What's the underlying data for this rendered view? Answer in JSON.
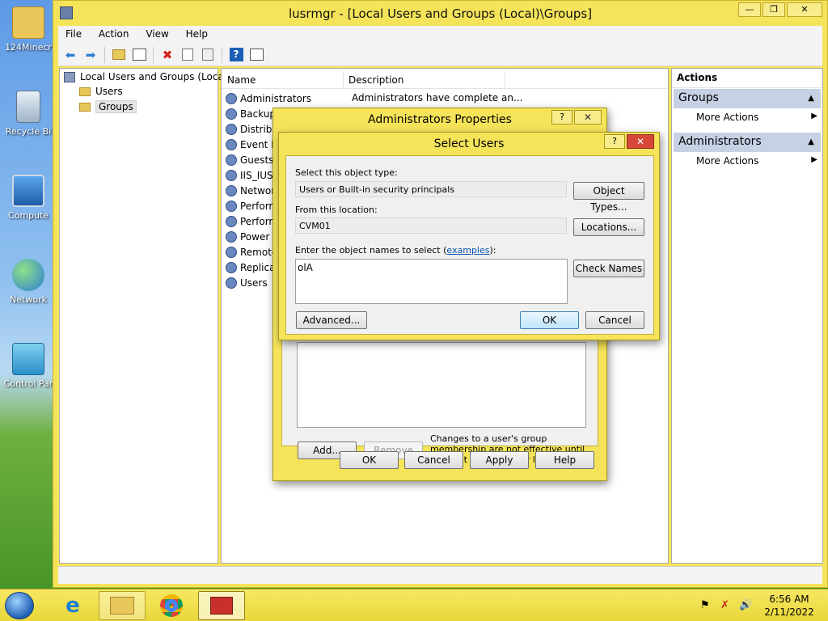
{
  "desktop": {
    "icons": [
      {
        "label": "124Minecr",
        "icon": "user-folder-icon"
      },
      {
        "label": "Recycle Bi",
        "icon": "recycle-bin-icon"
      },
      {
        "label": "Compute",
        "icon": "computer-icon"
      },
      {
        "label": "Network",
        "icon": "network-icon"
      },
      {
        "label": "Control Par",
        "icon": "control-panel-icon"
      }
    ]
  },
  "window": {
    "title": "lusrmgr - [Local Users and Groups (Local)\\Groups]",
    "menu": [
      "File",
      "Action",
      "View",
      "Help"
    ],
    "toolbar_icons": [
      "back-icon",
      "forward-icon",
      "up-folder-icon",
      "show-hide-tree-icon",
      "delete-icon",
      "properties-icon",
      "export-list-icon",
      "help-icon",
      "action-pane-icon"
    ]
  },
  "tree": {
    "root": "Local Users and Groups (Local)",
    "children": [
      "Users",
      "Groups"
    ],
    "selected": "Groups"
  },
  "list": {
    "columns": [
      "Name",
      "Description"
    ],
    "rows": [
      {
        "name": "Administrators",
        "description": "Administrators have complete an..."
      },
      {
        "name": "Backup",
        "description": ""
      },
      {
        "name": "Distribu",
        "description": ""
      },
      {
        "name": "Event Lo",
        "description": ""
      },
      {
        "name": "Guests",
        "description": ""
      },
      {
        "name": "IIS_IUSR",
        "description": ""
      },
      {
        "name": "Network",
        "description": ""
      },
      {
        "name": "Perform",
        "description": ""
      },
      {
        "name": "Perform",
        "description": ""
      },
      {
        "name": "Power U",
        "description": ""
      },
      {
        "name": "Remote",
        "description": ""
      },
      {
        "name": "Replicat",
        "description": ""
      },
      {
        "name": "Users",
        "description": ""
      }
    ]
  },
  "actions": {
    "title": "Actions",
    "sections": [
      {
        "header": "Groups",
        "items": [
          "More Actions"
        ]
      },
      {
        "header": "Administrators",
        "items": [
          "More Actions"
        ]
      }
    ]
  },
  "properties_dialog": {
    "title": "Administrators Properties",
    "help": "?",
    "close": "✕",
    "note": "Changes to a user's group membership are not effective until the next time the user logs on.",
    "add": "Add...",
    "remove": "Remove",
    "ok": "OK",
    "cancel": "Cancel",
    "apply": "Apply",
    "help_button": "Help"
  },
  "select_users_dialog": {
    "title": "Select Users",
    "help": "?",
    "close": "✕",
    "object_type_label": "Select this object type:",
    "object_type_value": "Users or Built-in security principals",
    "object_types_button": "Object Types...",
    "location_label": "From this location:",
    "location_value": "CVM01",
    "locations_button": "Locations...",
    "names_label_prefix": "Enter the object names to select (",
    "names_label_link": "examples",
    "names_label_suffix": "):",
    "names_value": "olA",
    "check_names_button": "Check Names",
    "advanced_button": "Advanced...",
    "ok": "OK",
    "cancel": "Cancel"
  },
  "taskbar": {
    "apps": [
      "internet-explorer-icon",
      "file-explorer-icon",
      "chrome-icon",
      "toolbox-icon"
    ],
    "tray_icons": [
      "flag-icon",
      "network-error-icon",
      "volume-icon"
    ],
    "time": "6:56 AM",
    "date": "2/11/2022"
  }
}
